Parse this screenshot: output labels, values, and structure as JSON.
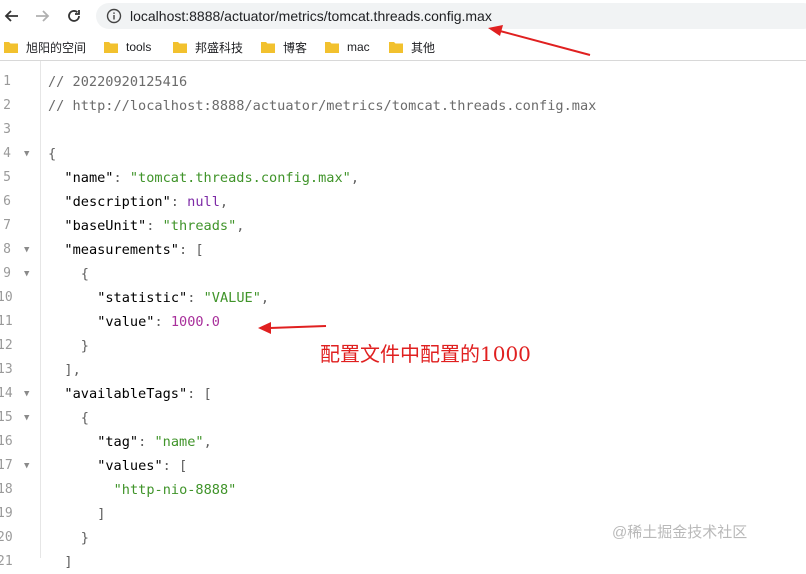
{
  "browser": {
    "url": "localhost:8888/actuator/metrics/tomcat.threads.config.max",
    "bookmarks": [
      "旭阳的空间",
      "tools",
      "邦盛科技",
      "博客",
      "mac",
      "其他"
    ]
  },
  "code_lines": [
    {
      "n": "1",
      "fold": "",
      "indent": 0,
      "parts": [
        {
          "t": "// 20220920125416",
          "c": "c"
        }
      ]
    },
    {
      "n": "2",
      "fold": "",
      "indent": 0,
      "parts": [
        {
          "t": "// http://localhost:8888/actuator/metrics/tomcat.threads.config.max",
          "c": "c"
        }
      ]
    },
    {
      "n": "3",
      "fold": "",
      "indent": 0,
      "parts": []
    },
    {
      "n": "4",
      "fold": "▼",
      "indent": 0,
      "parts": [
        {
          "t": "{",
          "c": "p"
        }
      ]
    },
    {
      "n": "5",
      "fold": "",
      "indent": 2,
      "parts": [
        {
          "t": "\"name\"",
          "c": "k2"
        },
        {
          "t": ": ",
          "c": "p"
        },
        {
          "t": "\"tomcat.threads.config.max\"",
          "c": "s"
        },
        {
          "t": ",",
          "c": "p"
        }
      ]
    },
    {
      "n": "6",
      "fold": "",
      "indent": 2,
      "parts": [
        {
          "t": "\"description\"",
          "c": "k2"
        },
        {
          "t": ": ",
          "c": "p"
        },
        {
          "t": "null",
          "c": "nul"
        },
        {
          "t": ",",
          "c": "p"
        }
      ]
    },
    {
      "n": "7",
      "fold": "",
      "indent": 2,
      "parts": [
        {
          "t": "\"baseUnit\"",
          "c": "k2"
        },
        {
          "t": ": ",
          "c": "p"
        },
        {
          "t": "\"threads\"",
          "c": "s"
        },
        {
          "t": ",",
          "c": "p"
        }
      ]
    },
    {
      "n": "8",
      "fold": "▼",
      "indent": 2,
      "parts": [
        {
          "t": "\"measurements\"",
          "c": "k2"
        },
        {
          "t": ": [",
          "c": "p"
        }
      ]
    },
    {
      "n": "9",
      "fold": "▼",
      "indent": 4,
      "parts": [
        {
          "t": "{",
          "c": "p"
        }
      ]
    },
    {
      "n": "10",
      "fold": "",
      "indent": 6,
      "parts": [
        {
          "t": "\"statistic\"",
          "c": "k2"
        },
        {
          "t": ": ",
          "c": "p"
        },
        {
          "t": "\"VALUE\"",
          "c": "s"
        },
        {
          "t": ",",
          "c": "p"
        }
      ]
    },
    {
      "n": "11",
      "fold": "",
      "indent": 6,
      "parts": [
        {
          "t": "\"value\"",
          "c": "k2"
        },
        {
          "t": ": ",
          "c": "p"
        },
        {
          "t": "1000.0",
          "c": "num"
        }
      ]
    },
    {
      "n": "12",
      "fold": "",
      "indent": 4,
      "parts": [
        {
          "t": "}",
          "c": "p"
        }
      ]
    },
    {
      "n": "13",
      "fold": "",
      "indent": 2,
      "parts": [
        {
          "t": "],",
          "c": "p"
        }
      ]
    },
    {
      "n": "14",
      "fold": "▼",
      "indent": 2,
      "parts": [
        {
          "t": "\"availableTags\"",
          "c": "k2"
        },
        {
          "t": ": [",
          "c": "p"
        }
      ]
    },
    {
      "n": "15",
      "fold": "▼",
      "indent": 4,
      "parts": [
        {
          "t": "{",
          "c": "p"
        }
      ]
    },
    {
      "n": "16",
      "fold": "",
      "indent": 6,
      "parts": [
        {
          "t": "\"tag\"",
          "c": "k2"
        },
        {
          "t": ": ",
          "c": "p"
        },
        {
          "t": "\"name\"",
          "c": "s"
        },
        {
          "t": ",",
          "c": "p"
        }
      ]
    },
    {
      "n": "17",
      "fold": "▼",
      "indent": 6,
      "parts": [
        {
          "t": "\"values\"",
          "c": "k2"
        },
        {
          "t": ": [",
          "c": "p"
        }
      ]
    },
    {
      "n": "18",
      "fold": "",
      "indent": 8,
      "parts": [
        {
          "t": "\"http-nio-8888\"",
          "c": "s"
        }
      ]
    },
    {
      "n": "19",
      "fold": "",
      "indent": 6,
      "parts": [
        {
          "t": "]",
          "c": "p"
        }
      ]
    },
    {
      "n": "20",
      "fold": "",
      "indent": 4,
      "parts": [
        {
          "t": "}",
          "c": "p"
        }
      ]
    },
    {
      "n": "21",
      "fold": "",
      "indent": 2,
      "parts": [
        {
          "t": "]",
          "c": "p"
        }
      ]
    }
  ],
  "annotations": {
    "note": "配置文件中配置的1000",
    "note_color": "#e02020"
  },
  "watermark": "@稀土掘金技术社区"
}
